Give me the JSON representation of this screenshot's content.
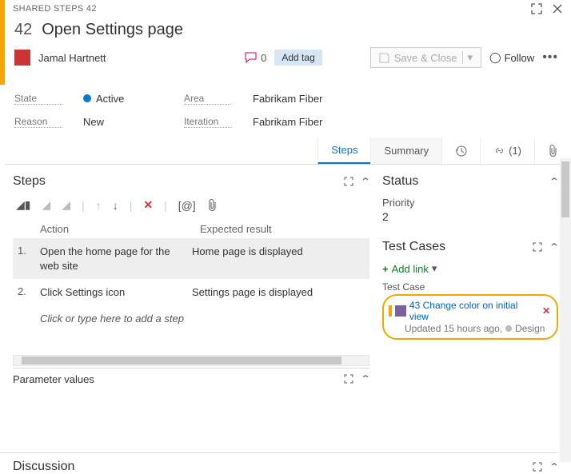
{
  "titlebar": {
    "breadcrumb": "SHARED STEPS 42"
  },
  "header": {
    "id": "42",
    "title": "Open Settings page"
  },
  "assigned_to": "Jamal Hartnett",
  "comments": "0",
  "add_tag": "Add tag",
  "save_close": "Save & Close",
  "follow": "Follow",
  "fields": {
    "state_label": "State",
    "state_value": "Active",
    "reason_label": "Reason",
    "reason_value": "New",
    "area_label": "Area",
    "area_value": "Fabrikam Fiber",
    "iteration_label": "Iteration",
    "iteration_value": "Fabrikam Fiber"
  },
  "tabs": {
    "steps": "Steps",
    "summary": "Summary",
    "links_count": "(1)"
  },
  "steps_section": {
    "title": "Steps",
    "col_action": "Action",
    "col_expected": "Expected result",
    "rows": [
      {
        "num": "1.",
        "action": "Open the home page for the web site",
        "expected": "Home page is displayed"
      },
      {
        "num": "2.",
        "action": "Click Settings icon",
        "expected": "Settings page is displayed"
      }
    ],
    "placeholder": "Click or type here to add a step",
    "param_values": "Parameter values"
  },
  "status": {
    "title": "Status",
    "priority_label": "Priority",
    "priority_value": "2"
  },
  "test_cases": {
    "title": "Test Cases",
    "add_link": "Add link",
    "label": "Test Case",
    "card": {
      "id": "43",
      "name": "Change color on initial view",
      "updated": "Updated 15 hours ago,",
      "state": "Design"
    }
  },
  "discussion": {
    "title": "Discussion"
  },
  "toolbar_param": "[@]"
}
